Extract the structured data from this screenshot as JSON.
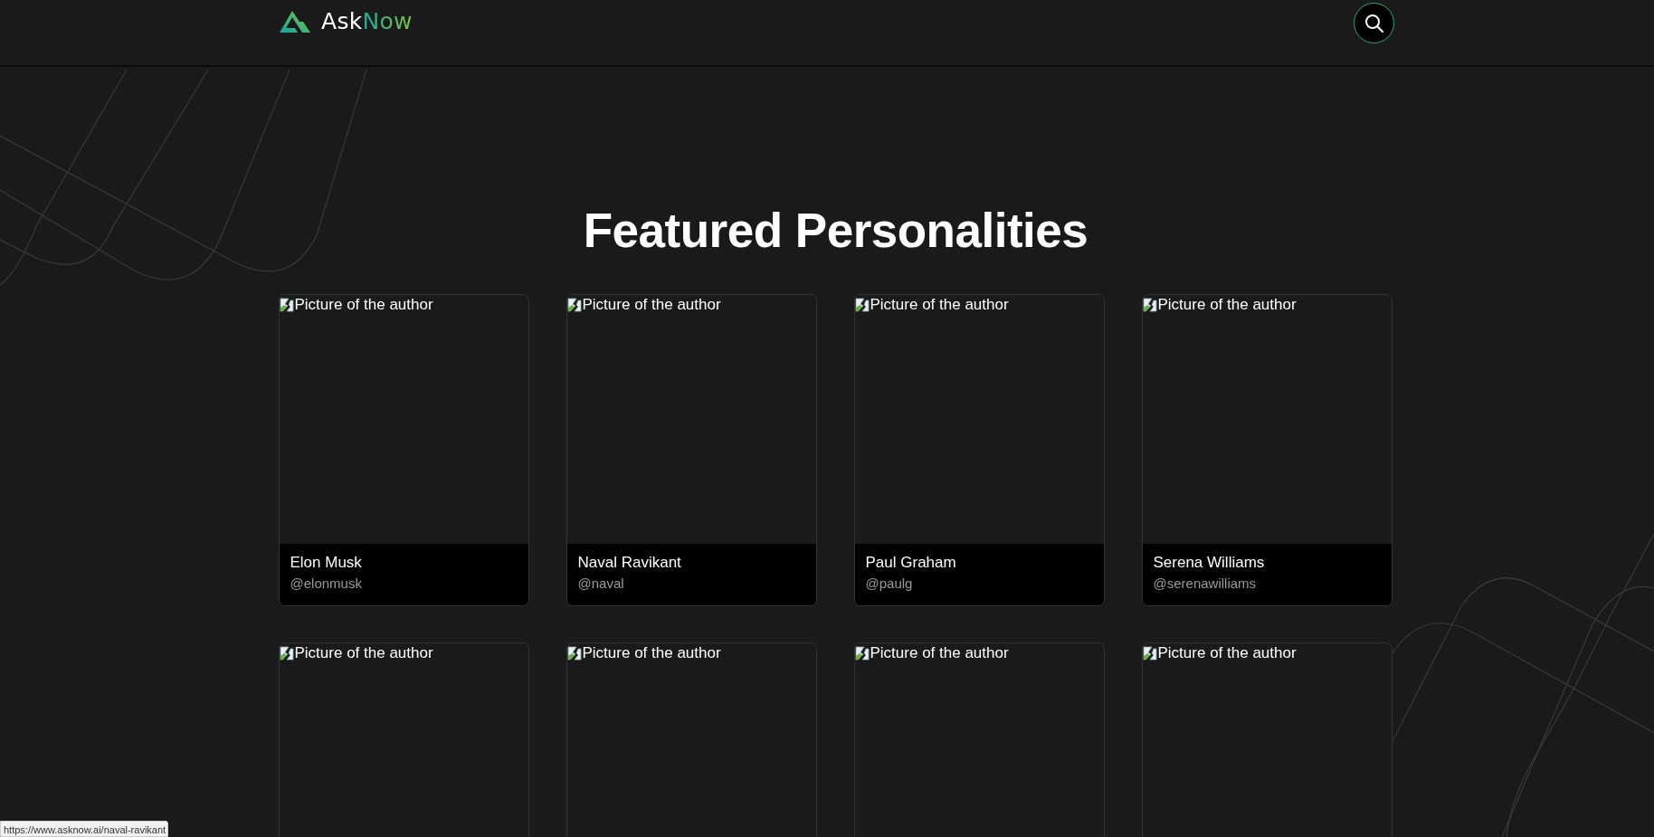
{
  "header": {
    "logo": {
      "first": "Ask",
      "second": "Now"
    },
    "search_button": {
      "kind": "icon"
    }
  },
  "title": "Featured Personalities",
  "cards": [
    {
      "alt": "Picture of the author",
      "name": "Elon Musk",
      "handle": "@elonmusk"
    },
    {
      "alt": "Picture of the author",
      "name": "Naval Ravikant",
      "handle": "@naval"
    },
    {
      "alt": "Picture of the author",
      "name": "Paul Graham",
      "handle": "@paulg"
    },
    {
      "alt": "Picture of the author",
      "name": "Serena Williams",
      "handle": "@serenawilliams"
    },
    {
      "alt": "Picture of the author"
    },
    {
      "alt": "Picture of the author"
    },
    {
      "alt": "Picture of the author"
    },
    {
      "alt": "Picture of the author"
    }
  ],
  "status_bar": {
    "url": "https://www.asknow.ai/naval-ravikant"
  }
}
